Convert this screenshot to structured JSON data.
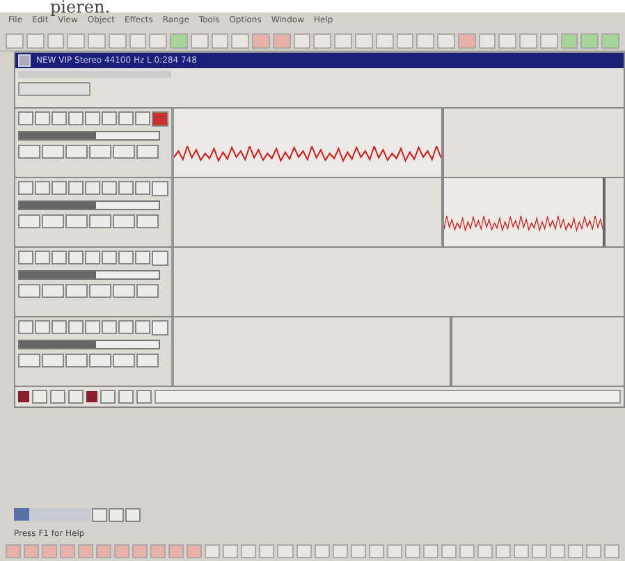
{
  "caption_fragment": "pieren.",
  "menu": [
    "File",
    "Edit",
    "View",
    "Object",
    "Effects",
    "Range",
    "Tools",
    "Options",
    "Window",
    "Help"
  ],
  "document": {
    "title": "NEW VIP Stereo 44100 Hz L 0:284 748"
  },
  "tracks": [
    {
      "armed": true,
      "level": 0.55,
      "segments": [
        {
          "kind": "wave"
        },
        {
          "kind": "empty"
        }
      ]
    },
    {
      "armed": false,
      "level": 0.55,
      "segments": [
        {
          "kind": "empty"
        },
        {
          "kind": "wave"
        }
      ]
    },
    {
      "armed": false,
      "level": 0.55,
      "segments": [
        {
          "kind": "empty"
        }
      ]
    },
    {
      "armed": false,
      "level": 0.55,
      "segments": [
        {
          "kind": "empty"
        },
        {
          "kind": "empty"
        }
      ]
    }
  ],
  "zoom": {
    "level": 0.2
  },
  "status_bar": "Press F1 for Help"
}
